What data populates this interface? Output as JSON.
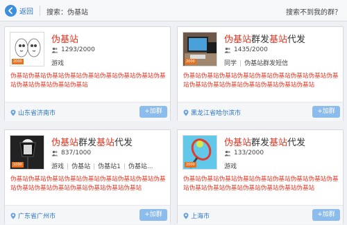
{
  "header": {
    "back_label": "返回",
    "search_text": "搜索：伪基站",
    "not_found_label": "搜索不到我的群？"
  },
  "groups": [
    {
      "name_highlight": "伪基站",
      "name_rest_1": "",
      "name_highlight_2": "",
      "name_rest_2": "",
      "members": "1293/2000",
      "tag1": "游戏",
      "tag2": "",
      "tag3": "",
      "tag4": "",
      "level_badge": "2000",
      "description": "伪基站伪基站伪基站伪基站伪基站伪基站伪基站伪基站伪基站伪基站伪基站伪基站伪基站",
      "location": "山东省济南市",
      "join_label": "+加群"
    },
    {
      "name_highlight": "伪基站",
      "name_rest_1": "群发",
      "name_highlight_2": "基站",
      "name_rest_2": "代发",
      "members": "1435/2000",
      "tag1": "同学",
      "tag2": "伪基站群发短信",
      "tag3": "",
      "tag4": "",
      "level_badge": "2000",
      "description": "伪基站伪基站伪基站伪基站伪基站伪基站伪基站伪基站伪基站伪基站伪基站伪基站伪基站伪基站伪基站伪基站",
      "location": "黑龙江省哈尔滨市",
      "join_label": "+加群"
    },
    {
      "name_highlight": "伪基站",
      "name_rest_1": "群发",
      "name_highlight_2": "基站",
      "name_rest_2": "代发",
      "members": "837/1000",
      "tag1": "游戏",
      "tag2": "伪基站",
      "tag3": "伪基站1",
      "tag4": "伪基站...",
      "level_badge": "1000",
      "description": "伪基站伪基站伪基站伪基站伪基站伪基站伪基站伪基站伪基站伪基站伪基站伪基站伪基站伪基站伪基站伪基站",
      "location": "广东省广州市",
      "join_label": "+加群"
    },
    {
      "name_highlight": "伪基站",
      "name_rest_1": "群发",
      "name_highlight_2": "基站",
      "name_rest_2": "代发",
      "members": "133/2000",
      "tag1": "游戏",
      "tag2": "",
      "tag3": "",
      "tag4": "",
      "level_badge": "2000",
      "description": "伪基站伪基站伪基站伪基站伪基站伪基站伪基站伪基站伪基站伪基站伪基站伪基站伪基站伪基站伪基站伪基站",
      "location": "上海市",
      "join_label": "+加群"
    }
  ],
  "colors": {
    "accent_blue": "#2a76c9",
    "highlight_red": "#e8331f",
    "join_button": "#8cbcec",
    "level_badge": "#e8711f"
  },
  "icons": {
    "back": "left-arrow-circle-icon",
    "members": "people-icon",
    "location": "map-pin-icon"
  }
}
